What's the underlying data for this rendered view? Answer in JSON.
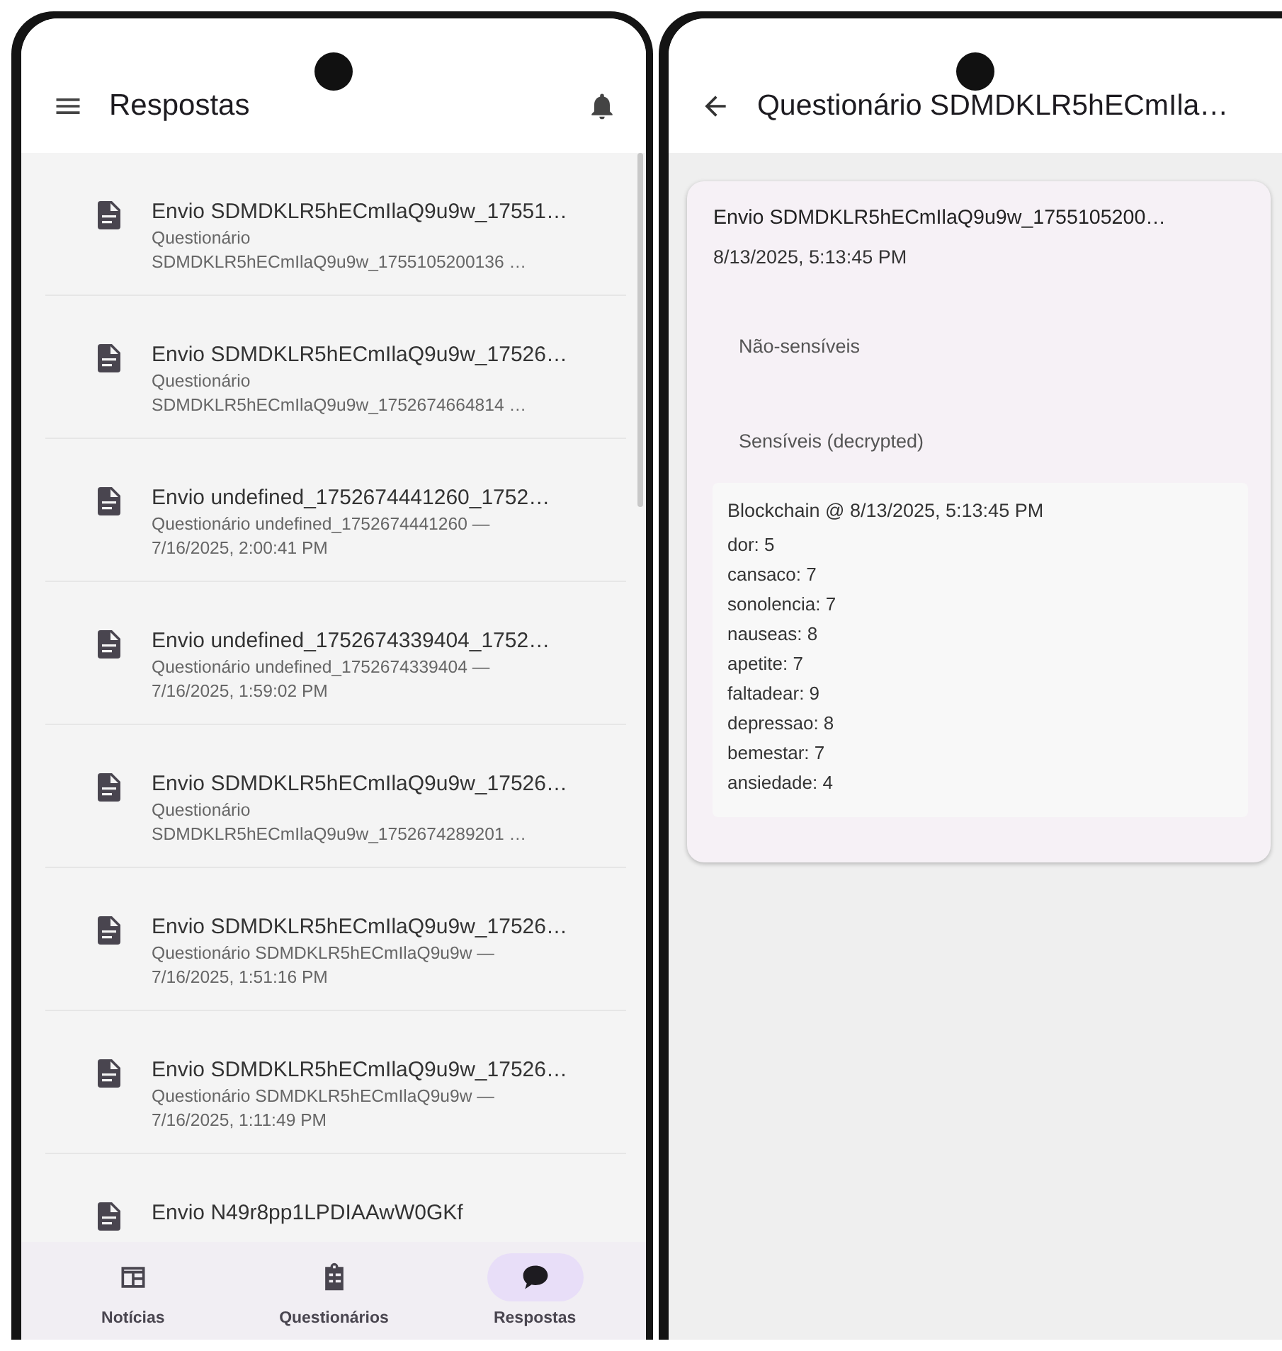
{
  "list_screen": {
    "header": {
      "title": "Respostas"
    },
    "items": [
      {
        "title": "Envio SDMDKLR5hECmIlaQ9u9w_17551…",
        "subtitle_lines": [
          "Questionário",
          "SDMDKLR5hECmIlaQ9u9w_1755105200136 …"
        ]
      },
      {
        "title": "Envio SDMDKLR5hECmIlaQ9u9w_17526…",
        "subtitle_lines": [
          "Questionário",
          "SDMDKLR5hECmIlaQ9u9w_1752674664814 …"
        ]
      },
      {
        "title": "Envio undefined_1752674441260_1752…",
        "subtitle_lines": [
          "Questionário undefined_1752674441260 —",
          "7/16/2025, 2:00:41 PM"
        ]
      },
      {
        "title": "Envio undefined_1752674339404_1752…",
        "subtitle_lines": [
          "Questionário undefined_1752674339404 —",
          "7/16/2025, 1:59:02 PM"
        ]
      },
      {
        "title": "Envio SDMDKLR5hECmIlaQ9u9w_17526…",
        "subtitle_lines": [
          "Questionário",
          "SDMDKLR5hECmIlaQ9u9w_1752674289201 …"
        ]
      },
      {
        "title": "Envio SDMDKLR5hECmIlaQ9u9w_17526…",
        "subtitle_lines": [
          "Questionário SDMDKLR5hECmIlaQ9u9w —",
          "7/16/2025, 1:51:16 PM"
        ]
      },
      {
        "title": "Envio SDMDKLR5hECmIlaQ9u9w_17526…",
        "subtitle_lines": [
          "Questionário SDMDKLR5hECmIlaQ9u9w —",
          "7/16/2025, 1:11:49 PM"
        ]
      },
      {
        "title": "Envio N49r8pp1LPDIAAwW0GKf"
      }
    ],
    "bottom_nav": [
      {
        "kind": "news",
        "label": "Notícias",
        "selected": false
      },
      {
        "kind": "clipboard",
        "label": "Questionários",
        "selected": false
      },
      {
        "kind": "chat",
        "label": "Respostas",
        "selected": true
      }
    ]
  },
  "detail_screen": {
    "header": {
      "title": "Questionário SDMDKLR5hECmIla…"
    },
    "card": {
      "title": "Envio SDMDKLR5hECmIlaQ9u9w_1755105200…",
      "timestamp": "8/13/2025, 5:13:45 PM",
      "sections": [
        "Não-sensíveis",
        "Sensíveis (decrypted)"
      ],
      "blockchain": {
        "heading": "Blockchain @ 8/13/2025, 5:13:45 PM",
        "entries": [
          "dor: 5",
          "cansaco: 7",
          "sonolencia: 7",
          "nauseas: 8",
          "apetite: 7",
          "faltadear: 9",
          "depressao: 8",
          "bemestar: 7",
          "ansiedade: 4"
        ]
      }
    }
  }
}
